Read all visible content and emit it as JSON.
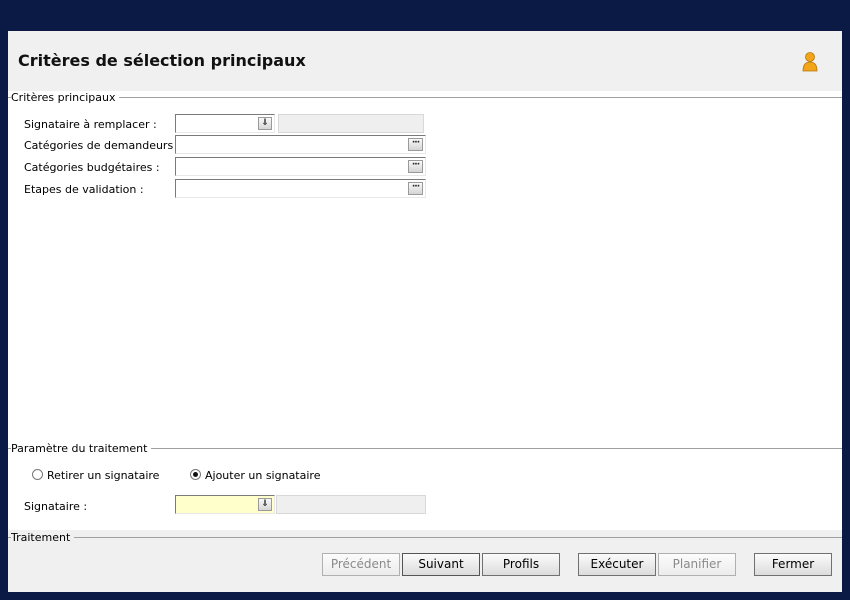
{
  "window": {
    "title": "Critères de sélection principaux",
    "header_icon": "person-icon"
  },
  "sections": {
    "main": {
      "legend": "Critères principaux",
      "fields": [
        {
          "label": "Signataire à remplacer :",
          "value": "",
          "type": "combo"
        },
        {
          "label": "Catégories de demandeurs :",
          "value": "",
          "type": "lookup"
        },
        {
          "label": "Catégories budgétaires :",
          "value": "",
          "type": "lookup"
        },
        {
          "label": "Etapes de validation :",
          "value": "",
          "type": "lookup"
        }
      ]
    },
    "params": {
      "legend": "Paramètre du traitement",
      "radio_remove": "Retirer un signataire",
      "radio_add": "Ajouter un signataire",
      "selected": "Ajouter un signataire",
      "signataire_label": "Signataire :",
      "signataire_value": ""
    },
    "traitement": {
      "legend": "Traitement"
    }
  },
  "buttons": {
    "previous": "Précédent",
    "next": "Suivant",
    "profiles": "Profils",
    "execute": "Exécuter",
    "schedule": "Planifier",
    "close": "Fermer"
  },
  "icons": {
    "combo": "double-chevron-down-icon",
    "lookup": "ellipsis-icon"
  }
}
